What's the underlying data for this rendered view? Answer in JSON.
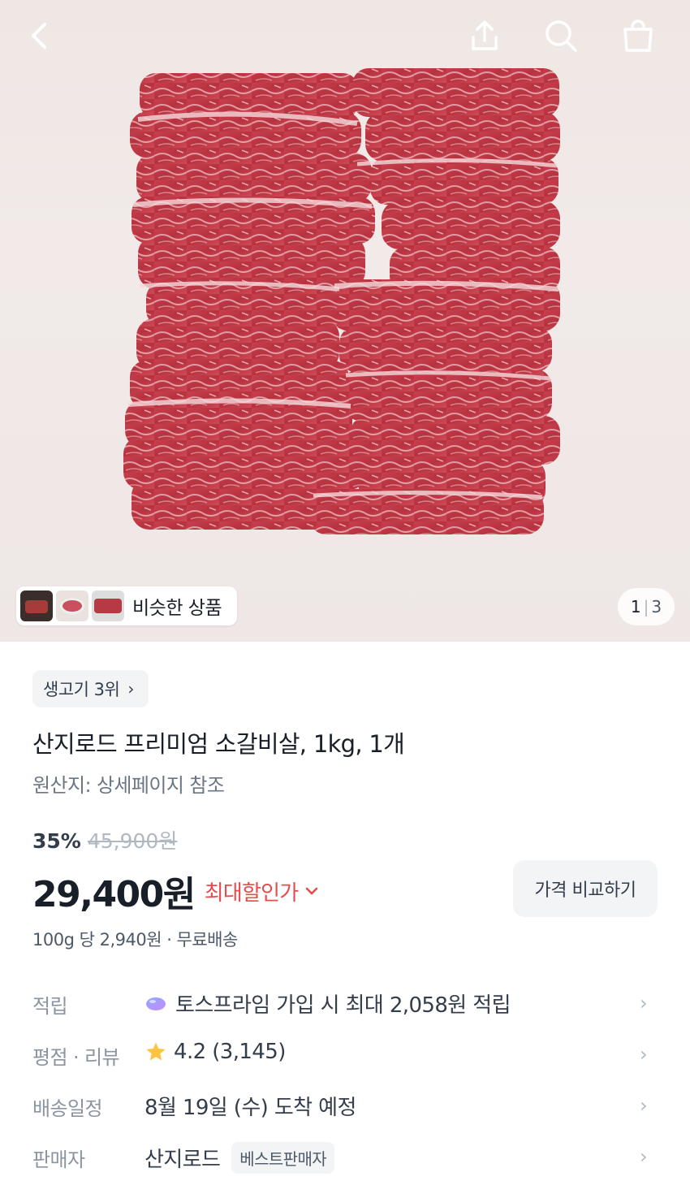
{
  "header": {
    "back_icon": "chevron-left-icon",
    "share_icon": "share-icon",
    "search_icon": "search-icon",
    "cart_icon": "shopping-bag-icon"
  },
  "gallery": {
    "similar_label": "비슷한 상품",
    "pager_current": "1",
    "pager_total": "3"
  },
  "product": {
    "rank_badge": "생고기 3위",
    "title": "산지로드 프리미엄 소갈비살, 1kg, 1개",
    "origin": "원산지: 상세페이지 참조",
    "discount_rate": "35%",
    "original_price": "45,900원",
    "price": "29,400원",
    "max_discount_label": "최대할인가",
    "compare_button": "가격 비교하기",
    "unit_price": "100g 당 2,940원 · 무료배송"
  },
  "details": {
    "points": {
      "label": "적립",
      "value": "토스프라임 가입 시 최대 2,058원 적립"
    },
    "rating": {
      "label": "평점 · 리뷰",
      "value": "4.2 (3,145)"
    },
    "delivery": {
      "label": "배송일정",
      "value": "8월 19일 (수) 도착 예정"
    },
    "seller": {
      "label": "판매자",
      "value": "산지로드",
      "badge": "베스트판매자"
    }
  },
  "colors": {
    "accent_red": "#e84b4b",
    "text_primary": "#191f28",
    "text_secondary": "#6b7684",
    "chip_bg": "#f2f4f6",
    "star": "#ffc342"
  }
}
